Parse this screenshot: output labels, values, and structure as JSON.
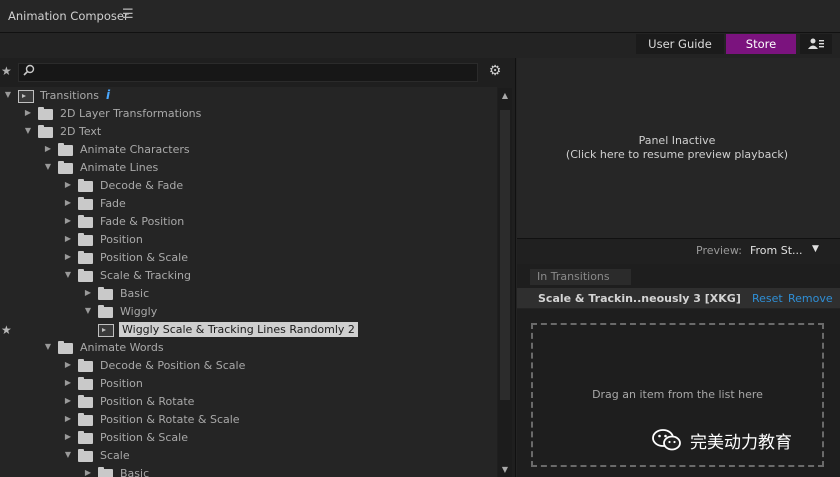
{
  "app": {
    "title": "Animation Composer",
    "menu_icon": "hamburger-icon"
  },
  "toolbar": {
    "user_guide": "User Guide",
    "store": "Store",
    "user_icon": "user-list-icon",
    "store_color": "#7b137e"
  },
  "search": {
    "value": "",
    "placeholder": ""
  },
  "tree": [
    {
      "label": "Transitions",
      "level": 0,
      "type": "root",
      "expanded": true,
      "info": "i"
    },
    {
      "label": "2D Layer Transformations",
      "level": 1,
      "type": "folder",
      "expanded": false
    },
    {
      "label": "2D Text",
      "level": 1,
      "type": "folder",
      "expanded": true
    },
    {
      "label": "Animate Characters",
      "level": 2,
      "type": "folder",
      "expanded": false
    },
    {
      "label": "Animate Lines",
      "level": 2,
      "type": "folder",
      "expanded": true
    },
    {
      "label": "Decode & Fade",
      "level": 3,
      "type": "folder",
      "expanded": false
    },
    {
      "label": "Fade",
      "level": 3,
      "type": "folder",
      "expanded": false
    },
    {
      "label": "Fade & Position",
      "level": 3,
      "type": "folder",
      "expanded": false
    },
    {
      "label": "Position",
      "level": 3,
      "type": "folder",
      "expanded": false
    },
    {
      "label": "Position & Scale",
      "level": 3,
      "type": "folder",
      "expanded": false
    },
    {
      "label": "Scale & Tracking",
      "level": 3,
      "type": "folder",
      "expanded": true
    },
    {
      "label": "Basic",
      "level": 4,
      "type": "folder",
      "expanded": false
    },
    {
      "label": "Wiggly",
      "level": 4,
      "type": "folder",
      "expanded": true
    },
    {
      "label": "Wiggly Scale & Tracking Lines Randomly 2",
      "level": 5,
      "type": "preset",
      "selected": true,
      "starred": true
    },
    {
      "label": "Animate Words",
      "level": 2,
      "type": "folder",
      "expanded": true
    },
    {
      "label": "Decode & Position & Scale",
      "level": 3,
      "type": "folder",
      "expanded": false
    },
    {
      "label": "Position",
      "level": 3,
      "type": "folder",
      "expanded": false
    },
    {
      "label": "Position & Rotate",
      "level": 3,
      "type": "folder",
      "expanded": false
    },
    {
      "label": "Position & Rotate & Scale",
      "level": 3,
      "type": "folder",
      "expanded": false
    },
    {
      "label": "Position & Scale",
      "level": 3,
      "type": "folder",
      "expanded": false
    },
    {
      "label": "Scale",
      "level": 3,
      "type": "folder",
      "expanded": true
    },
    {
      "label": "Basic",
      "level": 4,
      "type": "folder",
      "expanded": false
    }
  ],
  "preview": {
    "line1": "Panel Inactive",
    "line2": "(Click here to resume preview playback)",
    "label": "Preview:",
    "selected": "From St...",
    "caret": "▼"
  },
  "in_tab": "In Transitions",
  "selected_item": {
    "name": "Scale & Trackin..neously 3 [XKG]",
    "reset": "Reset",
    "remove": "Remove"
  },
  "drop": {
    "text": "Drag an item from the list here"
  },
  "watermark": {
    "text": "完美动力教育"
  }
}
